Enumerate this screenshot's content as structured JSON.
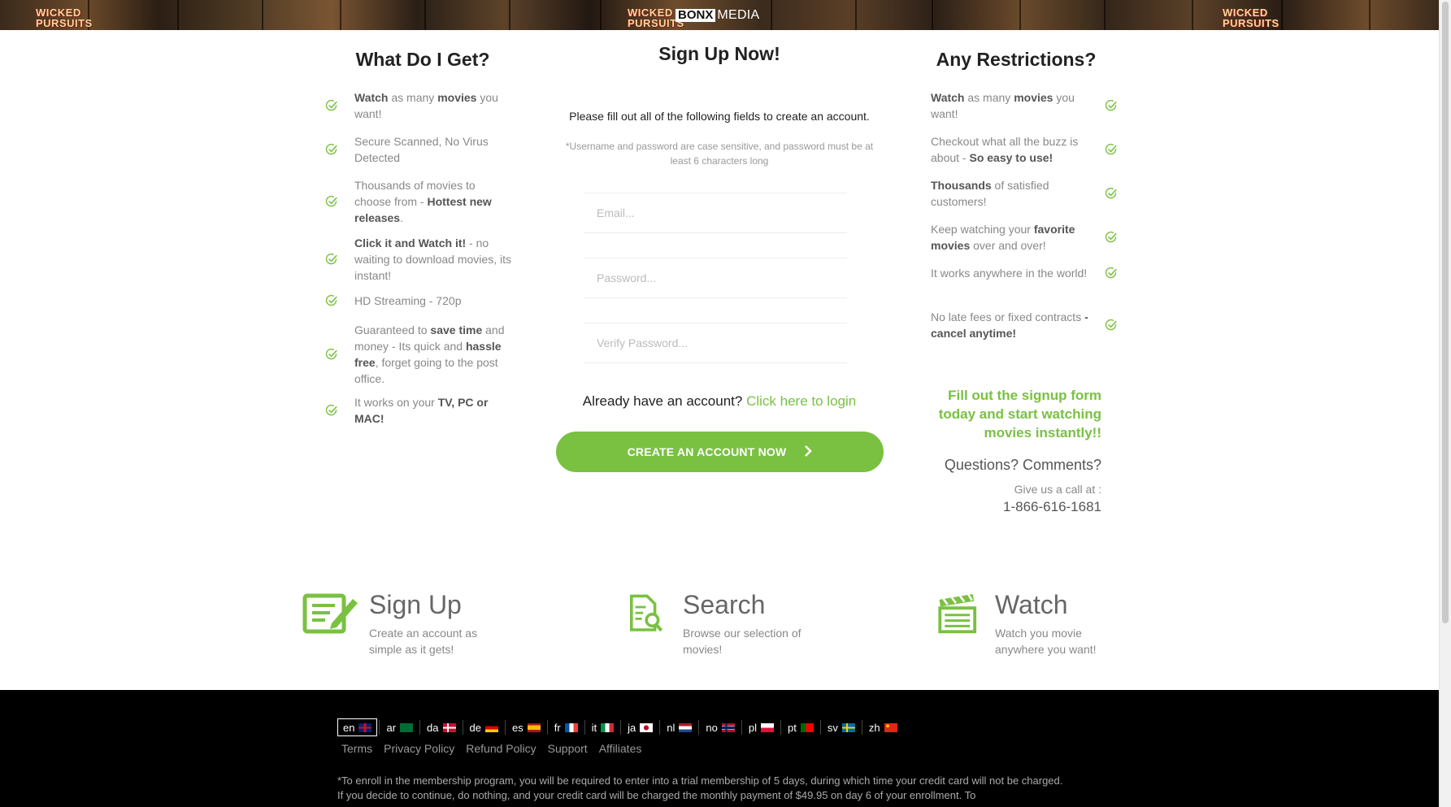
{
  "banner": {
    "brand_bold": "BONX",
    "brand_rest": "MEDIA",
    "poster_title": "WICKED PURSUITS"
  },
  "left_column": {
    "title": "What Do I Get?",
    "items": [
      {
        "html": "<b>Watch</b> as many <b>movies</b> you want!"
      },
      {
        "html": "Secure Scanned, No Virus Detected"
      },
      {
        "html": "Thousands of movies to choose from - <b>Hottest new releases</b>."
      },
      {
        "html": "<b>Click it and Watch it!</b> - no waiting to download movies, its instant!"
      },
      {
        "html": "HD Streaming - 720p"
      },
      {
        "html": "Guaranteed to <b>save time</b> and money - Its quick and <b>hassle free</b>, forget going to the post office."
      },
      {
        "html": "It works on your <b>TV, PC or MAC!</b>"
      }
    ]
  },
  "form": {
    "title": "Sign Up Now!",
    "intro": "Please fill out all of the following fields to create an account.",
    "note": "*Username and password are case sensitive, and password must be at least 6 characters long",
    "email_placeholder": "Email...",
    "password_placeholder": "Password...",
    "verify_placeholder": "Verify Password...",
    "already_text": "Already have an account?",
    "login_link": "Click here to login",
    "cta_label": "CREATE AN ACCOUNT NOW",
    "cta_arrow": "›"
  },
  "right_column": {
    "title": "Any Restrictions?",
    "items": [
      {
        "html": "<b>Watch</b> as many <b>movies</b> you want!"
      },
      {
        "html": "Checkout what all the buzz is about - <b>So easy to use!</b>"
      },
      {
        "html": "<b>Thousands</b> of satisfied customers!"
      },
      {
        "html": "Keep watching your <b>favorite movies</b> over and over!"
      },
      {
        "html": "It works anywhere in the world!"
      },
      {
        "html": "No late fees or fixed contracts <b>- cancel anytime!</b>"
      }
    ],
    "promo": "Fill out the signup form today and start watching movies instantly!!",
    "questions": "Questions? Comments?",
    "call_us": "Give us a call at :",
    "phone": "1-866-616-1681"
  },
  "steps": [
    {
      "title": "Sign Up",
      "desc": "Create an account as simple as it gets!",
      "icon": "signup-form-icon"
    },
    {
      "title": "Search",
      "desc": "Browse our selection of movies!",
      "icon": "search-document-icon"
    },
    {
      "title": "Watch",
      "desc": "Watch you movie anywhere you want!",
      "icon": "clapperboard-icon"
    }
  ],
  "footer": {
    "languages": [
      {
        "code": "en",
        "flag": "uk-flag-icon",
        "active": true
      },
      {
        "code": "ar",
        "flag": "saudi-flag-icon"
      },
      {
        "code": "da",
        "flag": "denmark-flag-icon"
      },
      {
        "code": "de",
        "flag": "germany-flag-icon"
      },
      {
        "code": "es",
        "flag": "spain-flag-icon"
      },
      {
        "code": "fr",
        "flag": "france-flag-icon"
      },
      {
        "code": "it",
        "flag": "italy-flag-icon"
      },
      {
        "code": "ja",
        "flag": "japan-flag-icon"
      },
      {
        "code": "nl",
        "flag": "netherlands-flag-icon"
      },
      {
        "code": "no",
        "flag": "norway-flag-icon"
      },
      {
        "code": "pl",
        "flag": "poland-flag-icon"
      },
      {
        "code": "pt",
        "flag": "portugal-flag-icon"
      },
      {
        "code": "sv",
        "flag": "sweden-flag-icon"
      },
      {
        "code": "zh",
        "flag": "china-flag-icon"
      }
    ],
    "links": [
      "Terms",
      "Privacy Policy",
      "Refund Policy",
      "Support",
      "Affiliates"
    ],
    "disclaimer": "*To enroll in the membership program, you will be required to enter into a trial membership of 5 days, during which time your credit card will not be charged. If you decide to continue, do nothing, and your credit card will be charged the monthly payment of $49.95 on day 6 of your enrollment. To"
  },
  "colors": {
    "accent": "#7ac142",
    "footer_bg": "#000000",
    "heading": "#222222",
    "body_text": "#888888"
  }
}
